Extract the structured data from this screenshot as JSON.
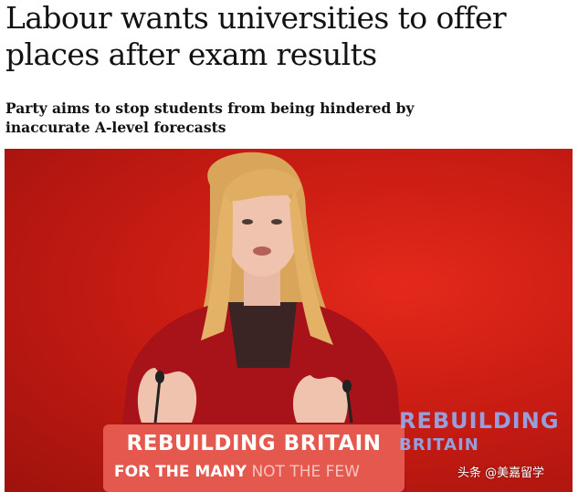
{
  "article": {
    "headline": "Labour wants universities to offer places after exam results",
    "standfirst": "Party aims to stop students from being hindered by inaccurate A-level forecasts"
  },
  "photo": {
    "podium_line1": "REBUILDING BRITAIN",
    "podium_line2_strong": "FOR THE MANY",
    "podium_line2_light": "NOT THE FEW",
    "background_sign_line1": "REBUILDING",
    "background_sign_line2": "BRITAIN",
    "colors": {
      "backdrop": "#c81c13",
      "podium": "#e5584e",
      "sign_text": "#8fb5ff"
    }
  },
  "watermark": {
    "text": "头条 @美嘉留学"
  }
}
